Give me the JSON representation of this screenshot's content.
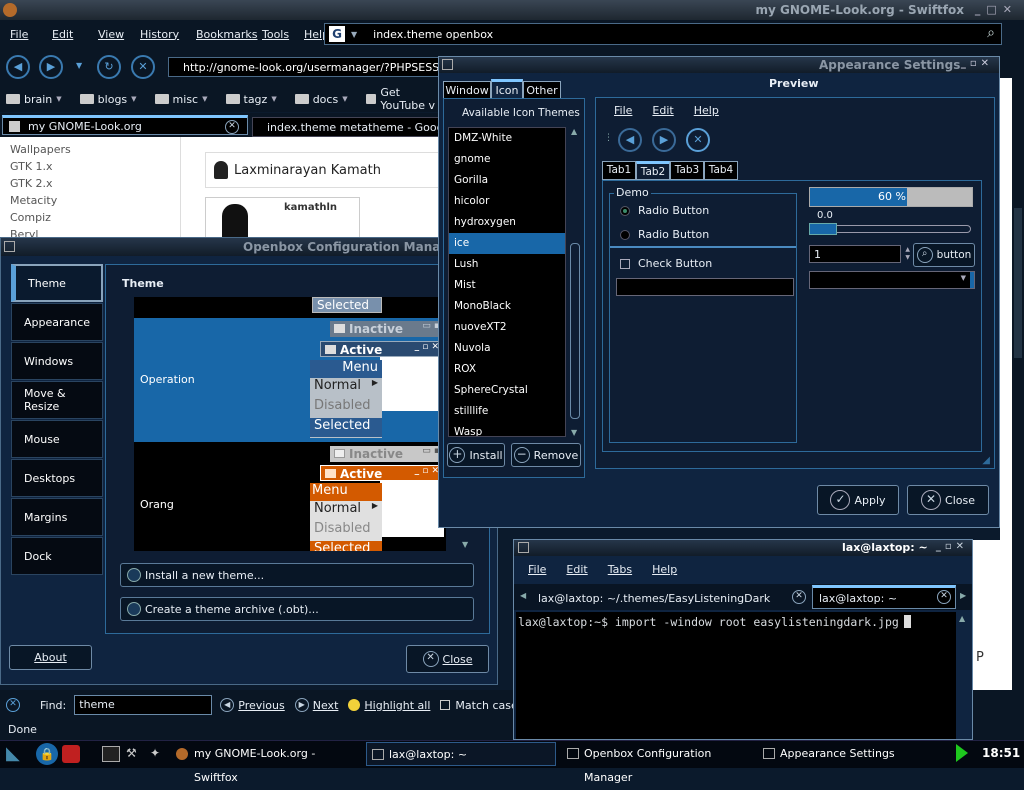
{
  "browser": {
    "title": "my GNOME-Look.org - Swiftfox",
    "menu": [
      "File",
      "Edit",
      "View",
      "History",
      "Bookmarks",
      "Tools",
      "Help"
    ],
    "search_value": "index.theme openbox",
    "url": "http://gnome-look.org/usermanager/?PHPSESSID",
    "bookmarks": [
      "brain",
      "blogs",
      "misc",
      "tagz",
      "docs",
      "Get YouTube v"
    ],
    "tabs": [
      "my GNOME-Look.org",
      "index.theme metatheme - Google"
    ],
    "left_links": [
      "Wallpapers",
      "GTK 1.x",
      "GTK 2.x",
      "Metacity",
      "Compiz",
      "Beryl"
    ],
    "profile_name": "Laxminarayan Kamath",
    "profile_user": "kamathln",
    "find_label": "Find:",
    "find_value": "theme",
    "find_previous": "Previous",
    "find_next": "Next",
    "find_highlight": "Highlight all",
    "find_match_case": "Match case",
    "status": "Done"
  },
  "openbox": {
    "title": "Openbox Configuration Manag",
    "sidebar": [
      "Theme",
      "Appearance",
      "Windows",
      "Move & Resize",
      "Mouse",
      "Desktops",
      "Margins",
      "Dock"
    ],
    "section_title": "Theme",
    "preview_selected_top": "Selected",
    "theme1_name": "Operation",
    "theme2_name": "Orang",
    "inactive": "Inactive",
    "active": "Active",
    "menu_header": "Menu",
    "menu_normal": "Normal",
    "menu_disabled": "Disabled",
    "menu_selected": "Selected",
    "install_button": "Install a new theme...",
    "archive_button": "Create a theme archive (.obt)...",
    "about_button": "About",
    "close_button": "Close"
  },
  "appearance": {
    "title": "Appearance Settings",
    "tabs": [
      "Window",
      "Icon",
      "Other"
    ],
    "list_header": "Available Icon Themes",
    "icon_themes": [
      "DMZ-White",
      "gnome",
      "Gorilla",
      "hicolor",
      "hydroxygen",
      "ice",
      "Lush",
      "Mist",
      "MonoBlack",
      "nuoveXT2",
      "Nuvola",
      "ROX",
      "SphereCrystal",
      "stilllife",
      "Wasp"
    ],
    "selected_theme": "ice",
    "install_button": "Install",
    "remove_button": "Remove",
    "preview_label": "Preview",
    "preview_menu": [
      "File",
      "Edit",
      "Help"
    ],
    "preview_tabs": [
      "Tab1",
      "Tab2",
      "Tab3",
      "Tab4"
    ],
    "demo_label": "Demo",
    "radio1": "Radio Button",
    "radio2": "Radio Button",
    "check": "Check Button",
    "progress_text": "60 %",
    "progress_value": 0.6,
    "scale_value": "0.0",
    "spin_value": "1",
    "preview_button": "button",
    "apply_button": "Apply",
    "close_button": "Close"
  },
  "terminal": {
    "title": "lax@laxtop: ~",
    "menu": [
      "File",
      "Edit",
      "Tabs",
      "Help"
    ],
    "tabs": [
      "lax@laxtop: ~/.themes/EasyListeningDark",
      "lax@laxtop: ~"
    ],
    "command_line": "lax@laxtop:~$ import -window root easylisteningdark.jpg"
  },
  "taskbar": {
    "tasks": [
      "my GNOME-Look.org - Swiftfox",
      "lax@laxtop: ~",
      "Openbox Configuration Manager",
      "Appearance Settings"
    ],
    "clock": "18:51"
  },
  "colors": {
    "accent": "#1867a8",
    "orange": "#d35a00",
    "panel": "#0f2440"
  }
}
